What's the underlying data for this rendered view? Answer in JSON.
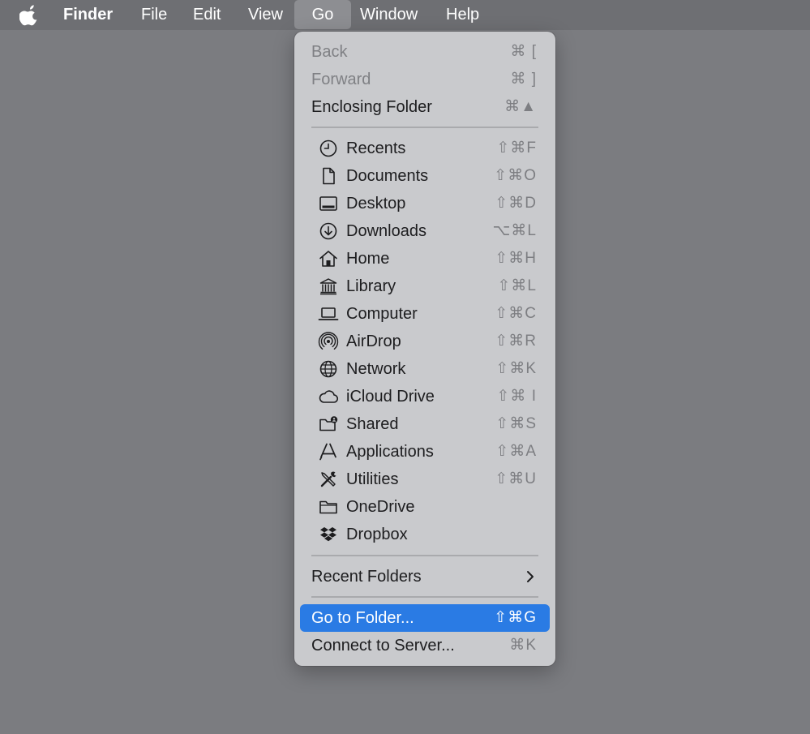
{
  "menubar": {
    "apple_icon": "apple-logo-icon",
    "items": [
      "Finder",
      "File",
      "Edit",
      "View",
      "Go",
      "Window",
      "Help"
    ],
    "active_item": "Go"
  },
  "go_menu": {
    "back": {
      "label": "Back",
      "shortcut": "⌘ [",
      "enabled": false
    },
    "forward": {
      "label": "Forward",
      "shortcut": "⌘ ]",
      "enabled": false
    },
    "enclosing_folder": {
      "label": "Enclosing Folder",
      "shortcut": "⌘▲"
    },
    "locations": [
      {
        "label": "Recents",
        "shortcut": "⇧⌘F",
        "icon": "clock-icon"
      },
      {
        "label": "Documents",
        "shortcut": "⇧⌘O",
        "icon": "document-icon"
      },
      {
        "label": "Desktop",
        "shortcut": "⇧⌘D",
        "icon": "desktop-icon"
      },
      {
        "label": "Downloads",
        "shortcut": "⌥⌘L",
        "icon": "download-icon"
      },
      {
        "label": "Home",
        "shortcut": "⇧⌘H",
        "icon": "house-icon"
      },
      {
        "label": "Library",
        "shortcut": "⇧⌘L",
        "icon": "library-icon"
      },
      {
        "label": "Computer",
        "shortcut": "⇧⌘C",
        "icon": "laptop-icon"
      },
      {
        "label": "AirDrop",
        "shortcut": "⇧⌘R",
        "icon": "airdrop-icon"
      },
      {
        "label": "Network",
        "shortcut": "⇧⌘K",
        "icon": "globe-icon"
      },
      {
        "label": "iCloud Drive",
        "shortcut": "⇧⌘ I",
        "icon": "cloud-icon"
      },
      {
        "label": "Shared",
        "shortcut": "⇧⌘S",
        "icon": "shared-folder-icon"
      },
      {
        "label": "Applications",
        "shortcut": "⇧⌘A",
        "icon": "applications-icon"
      },
      {
        "label": "Utilities",
        "shortcut": "⇧⌘U",
        "icon": "tools-icon"
      },
      {
        "label": "OneDrive",
        "shortcut": "",
        "icon": "folder-icon"
      },
      {
        "label": "Dropbox",
        "shortcut": "",
        "icon": "dropbox-icon"
      }
    ],
    "recent_folders": {
      "label": "Recent Folders",
      "icon": "chevron-right-icon"
    },
    "go_to_folder": {
      "label": "Go to Folder...",
      "shortcut": "⇧⌘G",
      "highlighted": true
    },
    "connect_to_server": {
      "label": "Connect to Server...",
      "shortcut": "⌘K"
    }
  },
  "colors": {
    "desktop": "#7b7c80",
    "menubar": "#6e6f73",
    "menu_background": "#c9cacd",
    "highlight": "#2a7be4",
    "disabled_text": "#7f8084"
  }
}
